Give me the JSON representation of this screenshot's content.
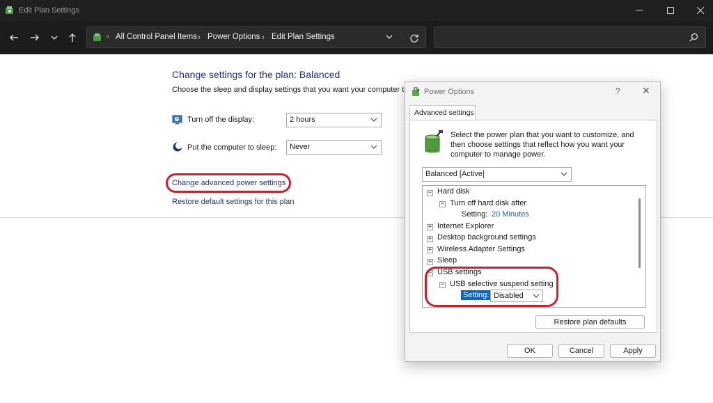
{
  "window": {
    "title": "Edit Plan Settings",
    "minimize_icon": "minimize-icon",
    "maximize_icon": "maximize-icon",
    "close_icon": "close-icon"
  },
  "nav": {
    "back_icon": "arrow-left-icon",
    "forward_icon": "arrow-right-icon",
    "recent_icon": "chevron-down-icon",
    "up_icon": "arrow-up-icon",
    "breadcrumbs": [
      "All Control Panel Items",
      "Power Options",
      "Edit Plan Settings"
    ],
    "separator": "›",
    "overflow": "«",
    "search_placeholder": ""
  },
  "main": {
    "title": "Change settings for the plan: Balanced",
    "description": "Choose the sleep and display settings that you want your computer to",
    "display_label": "Turn off the display:",
    "display_value": "2 hours",
    "sleep_label": "Put the computer to sleep:",
    "sleep_value": "Never",
    "advanced_link": "Change advanced power settings",
    "restore_link": "Restore default settings for this plan"
  },
  "dialog": {
    "title": "Power Options",
    "help": "?",
    "close": "✕",
    "tab": "Advanced settings",
    "description": "Select the power plan that you want to customize, and then choose settings that reflect how you want your computer to manage power.",
    "plan_value": "Balanced [Active]",
    "tree": {
      "hard_disk": "Hard disk",
      "turn_off_hdd": "Turn off hard disk after",
      "setting_label": "Setting:",
      "hdd_value": "20 Minutes",
      "ie": "Internet Explorer",
      "desktop_bg": "Desktop background settings",
      "wireless": "Wireless Adapter Settings",
      "sleep": "Sleep",
      "usb": "USB settings",
      "usb_suspend": "USB selective suspend setting",
      "usb_setting_label": "Setting:",
      "usb_value": "Disabled"
    },
    "restore_button": "Restore plan defaults",
    "ok": "OK",
    "cancel": "Cancel",
    "apply": "Apply"
  },
  "colors": {
    "annotation": "#d21e2a",
    "link": "#1e3287",
    "selection": "#0a64c8"
  }
}
